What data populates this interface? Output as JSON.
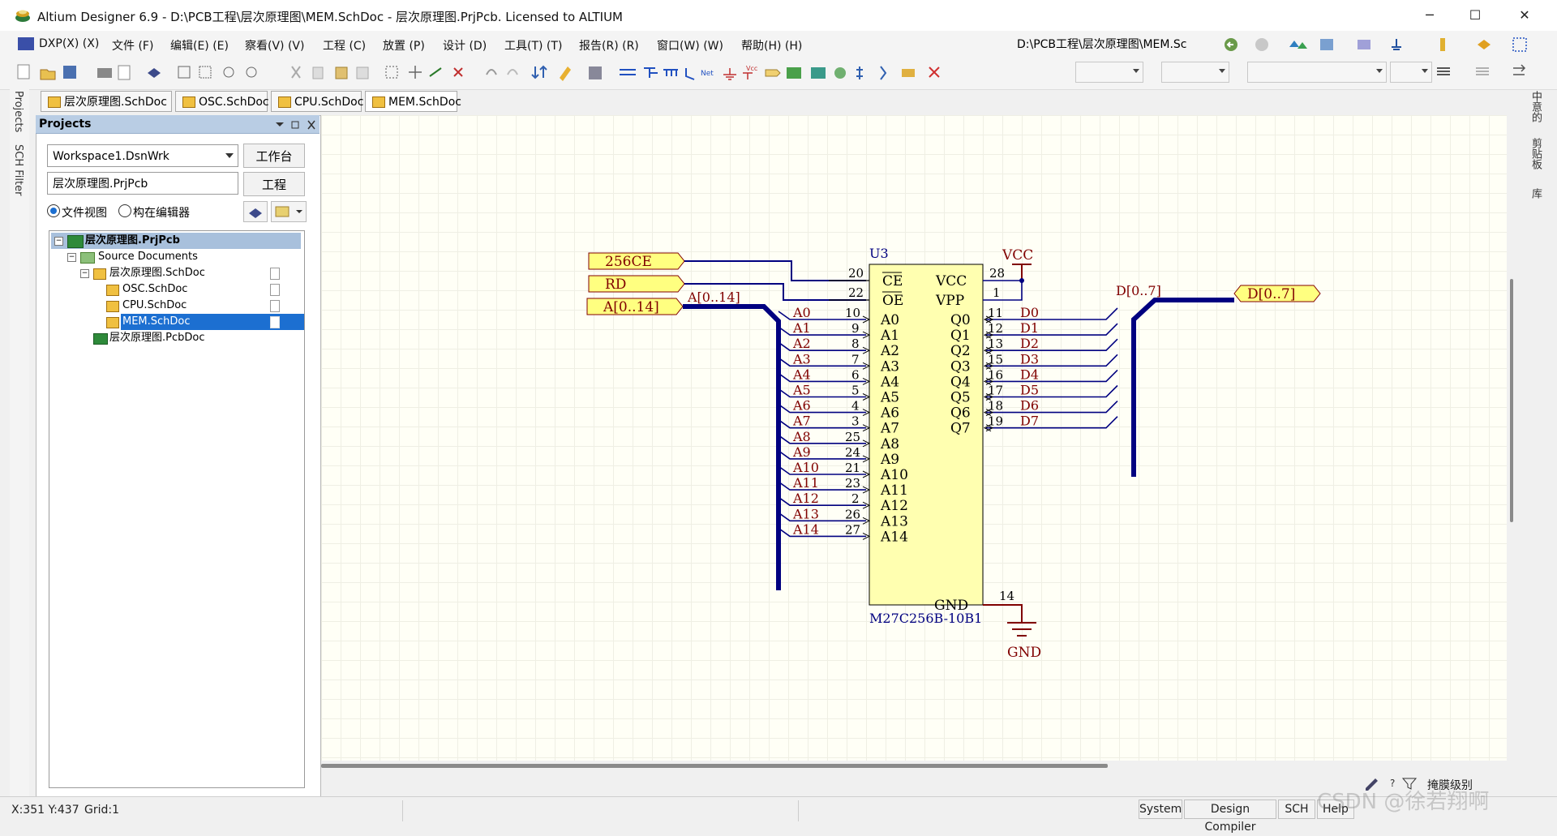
{
  "window": {
    "title": "Altium Designer 6.9 - D:\\PCB工程\\层次原理图\\MEM.SchDoc - 层次原理图.PrjPcb. Licensed to ALTIUM",
    "minimize": "─",
    "maximize": "☐",
    "close": "✕"
  },
  "menu": {
    "items": [
      "DXP(X) (X)",
      "文件 (F)",
      "编辑(E) (E)",
      "察看(V) (V)",
      "工程 (C)",
      "放置 (P)",
      "设计 (D)",
      "工具(T) (T)",
      "报告(R) (R)",
      "窗口(W) (W)",
      "帮助(H) (H)"
    ],
    "path": "D:\\PCB工程\\层次原理图\\MEM.Sc"
  },
  "doc_tabs": [
    "层次原理图.SchDoc",
    "OSC.SchDoc",
    "CPU.SchDoc",
    "MEM.SchDoc"
  ],
  "side_tabs": {
    "projects": "Projects",
    "sch_filter": "SCH Filter"
  },
  "right_tabs": [
    "中意的",
    "剪贴板",
    "库"
  ],
  "panel": {
    "title": "Projects",
    "workspace": "Workspace1.DsnWrk",
    "workspace_btn": "工作台",
    "project": "层次原理图.PrjPcb",
    "project_btn": "工程",
    "radio_file_view": "文件视图",
    "radio_struct": "构在编辑器",
    "tree": {
      "root": "层次原理图.PrjPcb",
      "source_folder": "Source Documents",
      "top_sheet": "层次原理图.SchDoc",
      "children": [
        "OSC.SchDoc",
        "CPU.SchDoc",
        "MEM.SchDoc"
      ],
      "pcb": "层次原理图.PcbDoc"
    }
  },
  "schematic": {
    "ports": {
      "ce": "256CE",
      "rd": "RD",
      "addr": "A[0..14]",
      "data": "D[0..7]"
    },
    "net_labels": {
      "addr_bus": "A[0..14]",
      "data_bus": "D[0..7]",
      "vcc": "VCC",
      "gnd": "GND"
    },
    "chip": {
      "designator": "U3",
      "comment": "M27C256B-10B1",
      "left_top": [
        {
          "name": "CE",
          "num": "20"
        },
        {
          "name": "OE",
          "num": "22"
        }
      ],
      "right_top": [
        {
          "name": "VCC",
          "num": "28"
        },
        {
          "name": "VPP",
          "num": "1"
        }
      ],
      "addr": [
        {
          "name": "A0",
          "num": "10"
        },
        {
          "name": "A1",
          "num": "9"
        },
        {
          "name": "A2",
          "num": "8"
        },
        {
          "name": "A3",
          "num": "7"
        },
        {
          "name": "A4",
          "num": "6"
        },
        {
          "name": "A5",
          "num": "5"
        },
        {
          "name": "A6",
          "num": "4"
        },
        {
          "name": "A7",
          "num": "3"
        },
        {
          "name": "A8",
          "num": "25"
        },
        {
          "name": "A9",
          "num": "24"
        },
        {
          "name": "A10",
          "num": "21"
        },
        {
          "name": "A11",
          "num": "23"
        },
        {
          "name": "A12",
          "num": "2"
        },
        {
          "name": "A13",
          "num": "26"
        },
        {
          "name": "A14",
          "num": "27"
        }
      ],
      "data": [
        {
          "name": "Q0",
          "num": "11",
          "net": "D0"
        },
        {
          "name": "Q1",
          "num": "12",
          "net": "D1"
        },
        {
          "name": "Q2",
          "num": "13",
          "net": "D2"
        },
        {
          "name": "Q3",
          "num": "15",
          "net": "D3"
        },
        {
          "name": "Q4",
          "num": "16",
          "net": "D4"
        },
        {
          "name": "Q5",
          "num": "17",
          "net": "D5"
        },
        {
          "name": "Q6",
          "num": "18",
          "net": "D6"
        },
        {
          "name": "Q7",
          "num": "19",
          "net": "D7"
        }
      ],
      "gnd": {
        "name": "GND",
        "num": "14"
      }
    }
  },
  "statusbar": {
    "coords": "X:351 Y:437",
    "grid": "Grid:1",
    "buttons": [
      "System",
      "Design Compiler",
      "SCH",
      "Help"
    ],
    "mask": "掩膜级别",
    "watermark": "CSDN @徐若翔啊"
  },
  "colors": {
    "wire": "#000080",
    "net_red": "#800000",
    "port_fill": "#ffff80",
    "chip_fill": "#ffffb0",
    "canvas": "#fffff6"
  }
}
